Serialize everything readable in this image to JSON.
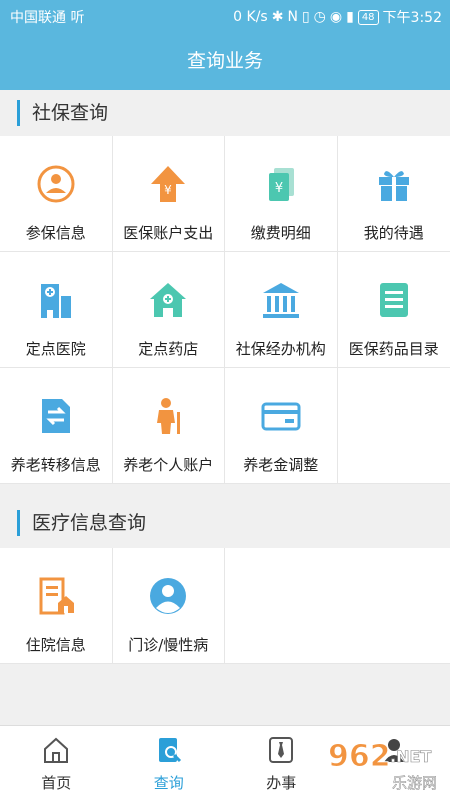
{
  "status_bar": {
    "carrier": "中国联通 听",
    "speed": "0 K/s",
    "battery": "48",
    "time": "下午3:52"
  },
  "header": {
    "title": "查询业务"
  },
  "sections": [
    {
      "title": "社保查询",
      "items": [
        {
          "label": "参保信息",
          "icon": "person-circle-icon"
        },
        {
          "label": "医保账户支出",
          "icon": "yuan-up-arrow-icon"
        },
        {
          "label": "缴费明细",
          "icon": "yuan-document-icon"
        },
        {
          "label": "我的待遇",
          "icon": "gift-icon"
        },
        {
          "label": "定点医院",
          "icon": "hospital-icon"
        },
        {
          "label": "定点药店",
          "icon": "pharmacy-house-icon"
        },
        {
          "label": "社保经办机构",
          "icon": "institution-building-icon"
        },
        {
          "label": "医保药品目录",
          "icon": "list-document-icon"
        },
        {
          "label": "养老转移信息",
          "icon": "transfer-document-icon"
        },
        {
          "label": "养老个人账户",
          "icon": "elderly-person-icon"
        },
        {
          "label": "养老金调整",
          "icon": "card-icon"
        }
      ]
    },
    {
      "title": "医疗信息查询",
      "items": [
        {
          "label": "住院信息",
          "icon": "inpatient-document-icon"
        },
        {
          "label": "门诊/慢性病",
          "icon": "doctor-avatar-icon"
        }
      ]
    }
  ],
  "tabs": [
    {
      "label": "首页",
      "icon": "home-icon"
    },
    {
      "label": "查询",
      "icon": "search-document-icon",
      "active": true
    },
    {
      "label": "办事",
      "icon": "tie-icon"
    },
    {
      "label": "",
      "icon": "profile-icon"
    }
  ],
  "watermark": {
    "text": "962.NET",
    "subtext": "乐游网"
  },
  "colors": {
    "primary": "#5ab7de",
    "accent_blue": "#2b9fd8",
    "orange": "#f29440",
    "teal": "#4cc7b0"
  }
}
